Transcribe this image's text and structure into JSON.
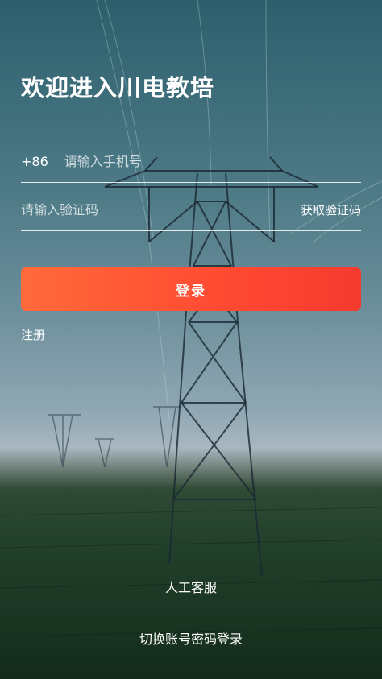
{
  "header": {
    "title": "欢迎进入川电教培"
  },
  "form": {
    "country_code": "+86",
    "phone_placeholder": "请输入手机号",
    "code_placeholder": "请输入验证码",
    "get_code_label": "获取验证码",
    "login_label": "登录",
    "register_label": "注册"
  },
  "footer": {
    "customer_service_label": "人工客服",
    "switch_login_label": "切换账号密码登录"
  },
  "colors": {
    "login_button_start": "#ff6a3a",
    "login_button_end": "#f43a2e"
  },
  "background": {
    "icon": "power-transmission-tower-photo"
  }
}
